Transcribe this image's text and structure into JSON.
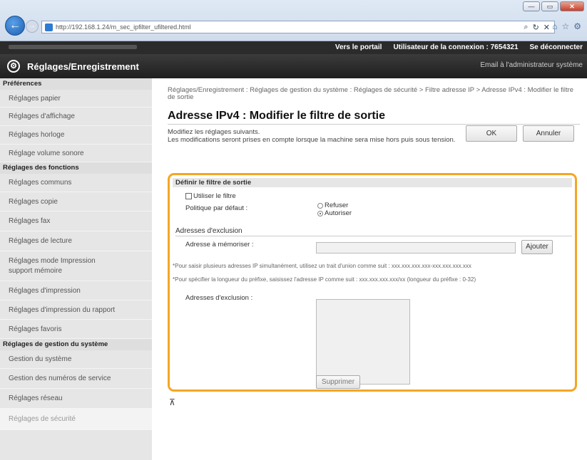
{
  "browser": {
    "url": "http://192.168.1.24/m_sec_ipfilter_ufiltered.html",
    "window_buttons": [
      "—",
      "▭",
      "✕"
    ]
  },
  "topbar": {
    "portal_link": "Vers le portail",
    "user_label": "Utilisateur de la connexion :",
    "user_id": "7654321",
    "logout": "Se déconnecter"
  },
  "header": {
    "title": "Réglages/Enregistrement",
    "admin_email": "Email à l'administrateur système"
  },
  "sidebar": {
    "sections": [
      {
        "title": "Préférences",
        "items": [
          "Réglages papier",
          "Réglages d'affichage",
          "Réglages horloge",
          "Réglage volume sonore"
        ]
      },
      {
        "title": "Réglages des fonctions",
        "items": [
          "Réglages communs",
          "Réglages copie",
          "Réglages fax",
          "Réglages de lecture",
          "Réglages mode Impression support mémoire",
          "Réglages d'impression",
          "Réglages d'impression du rapport",
          "Réglages favoris"
        ]
      },
      {
        "title": "Réglages de gestion du système",
        "items": [
          "Gestion du système",
          "Gestion des numéros de service",
          "Réglages réseau",
          "Réglages de sécurité"
        ]
      }
    ]
  },
  "main": {
    "breadcrumb": "Réglages/Enregistrement : Réglages de gestion du système : Réglages de sécurité > Filtre adresse IP > Adresse IPv4 : Modifier le filtre de sortie",
    "page_title": "Adresse IPv4 : Modifier le filtre de sortie",
    "intro_line1": "Modifiez les réglages suivants.",
    "intro_line2": "Les modifications seront prises en compte lorsque la machine sera mise hors puis sous tension.",
    "ok_label": "OK",
    "cancel_label": "Annuler",
    "panel": {
      "header": "Définir le filtre de sortie",
      "use_filter_label": "Utiliser le filtre",
      "default_policy_label": "Politique par défaut :",
      "policy_refuse": "Refuser",
      "policy_allow": "Autoriser",
      "exclusion_header": "Adresses d'exclusion",
      "address_to_save_label": "Adresse à mémoriser :",
      "address_value": "",
      "add_button": "Ajouter",
      "note1": "*Pour saisir plusieurs adresses IP simultanément, utilisez un trait d'union comme suit : xxx.xxx.xxx.xxx-xxx.xxx.xxx.xxx",
      "note2": "*Pour spécifier la longueur du préfixe, saisissez l'adresse IP comme suit : xxx.xxx.xxx.xxx/xx (longueur du préfixe : 0-32)",
      "exclusion_list_label": "Adresses d'exclusion :",
      "delete_button": "Supprimer"
    },
    "top_link": "⊼"
  }
}
